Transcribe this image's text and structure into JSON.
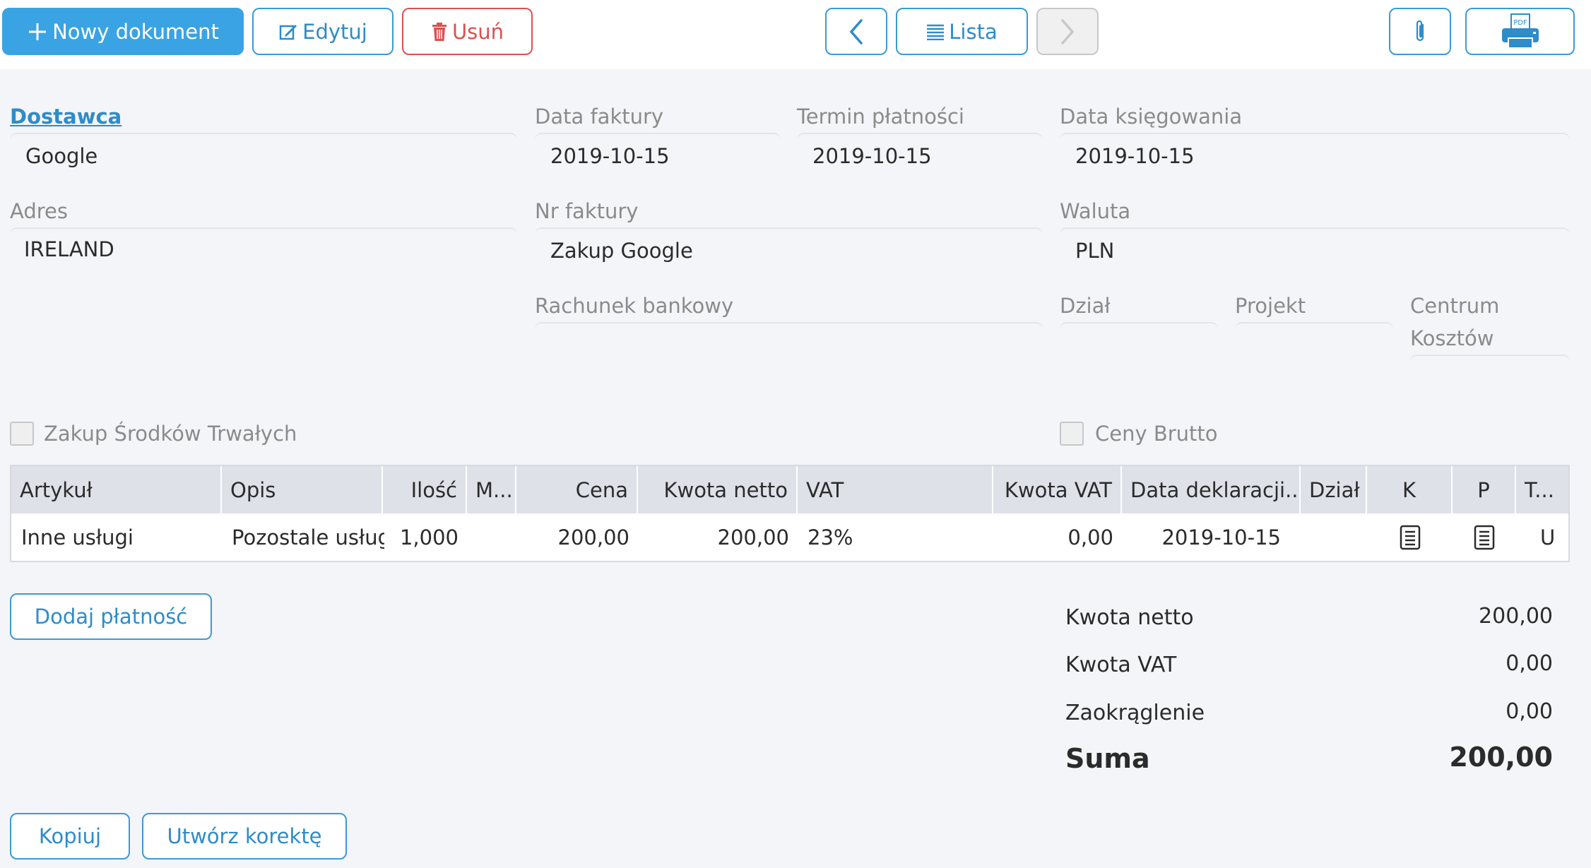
{
  "toolbar": {
    "new_document": "Nowy dokument",
    "edit": "Edytuj",
    "delete": "Usuń",
    "list": "Lista",
    "pdf_icon_text": "PDF"
  },
  "form": {
    "supplier": {
      "label": "Dostawca",
      "value": "Google"
    },
    "invoice_date": {
      "label": "Data faktury",
      "value": "2019-10-15"
    },
    "payment_term": {
      "label": "Termin płatności",
      "value": "2019-10-15"
    },
    "posting_date": {
      "label": "Data księgowania",
      "value": "2019-10-15"
    },
    "address": {
      "label": "Adres",
      "value": "IRELAND"
    },
    "invoice_no": {
      "label": "Nr faktury",
      "value": "Zakup Google"
    },
    "currency": {
      "label": "Waluta",
      "value": "PLN"
    },
    "bank_account": {
      "label": "Rachunek bankowy",
      "value": ""
    },
    "department": {
      "label": "Dział",
      "value": ""
    },
    "project": {
      "label": "Projekt",
      "value": ""
    },
    "cost_center": {
      "label_line1": "Centrum",
      "label_line2": "Kosztów",
      "value": ""
    },
    "fixed_assets": {
      "label": "Zakup Środków Trwałych",
      "checked": false
    },
    "gross_prices": {
      "label": "Ceny Brutto",
      "checked": false
    }
  },
  "grid": {
    "columns": [
      "Artykuł",
      "Opis",
      "Ilość",
      "M...",
      "Cena",
      "Kwota netto",
      "VAT",
      "Kwota VAT",
      "Data deklaracji...",
      "Dział",
      "K",
      "P",
      "T..."
    ],
    "rows": [
      {
        "article": "Inne usługi",
        "description": "Pozostale usługi",
        "quantity": "1,000",
        "unit": "",
        "price": "200,00",
        "net": "200,00",
        "vat": "23%",
        "vat_amount": "0,00",
        "declaration_date": "2019-10-15",
        "department": "",
        "t": "U"
      }
    ]
  },
  "actions": {
    "add_payment": "Dodaj płatność",
    "copy": "Kopiuj",
    "create_correction": "Utwórz korektę"
  },
  "summary": {
    "net_label": "Kwota netto",
    "net_value": "200,00",
    "vat_label": "Kwota VAT",
    "vat_value": "0,00",
    "rounding_label": "Zaokrąglenie",
    "rounding_value": "0,00",
    "total_label": "Suma",
    "total_value": "200,00"
  },
  "colors": {
    "accent": "#3aa3e3",
    "link": "#2e8cc8",
    "danger": "#d9534f",
    "background": "#f4f5f8",
    "grid_header": "#dfe1e8"
  }
}
